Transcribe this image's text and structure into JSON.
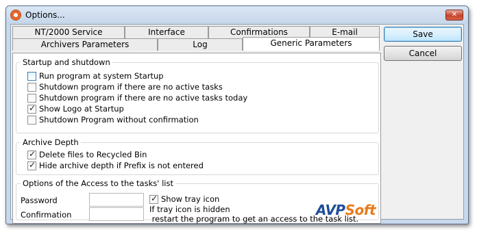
{
  "window": {
    "title": "Options...",
    "close_label": "✕"
  },
  "tabs": {
    "row1": [
      "NT/2000 Service",
      "Interface",
      "Confirmations",
      "E-mail"
    ],
    "row2": [
      "Archivers Parameters",
      "Log",
      "Generic Parameters"
    ],
    "active": "Generic Parameters"
  },
  "startup": {
    "title": "Startup and shutdown",
    "items": [
      {
        "label": "Run program at system Startup",
        "checked": false
      },
      {
        "label": "Shutdown program if there are no active tasks",
        "checked": false
      },
      {
        "label": "Shutdown program if there are no active tasks today",
        "checked": false
      },
      {
        "label": "Show Logo at Startup",
        "checked": true
      },
      {
        "label": "Shutdown Program without confirmation",
        "checked": false
      }
    ]
  },
  "archive": {
    "title": "Archive Depth",
    "items": [
      {
        "label": "Delete files to Recycled Bin",
        "checked": true
      },
      {
        "label": "Hide archive depth if Prefix is not entered",
        "checked": true
      }
    ]
  },
  "access": {
    "title": "Options of the Access to the tasks' list",
    "password_label": "Password",
    "password_value": "",
    "confirmation_label": "Confirmation",
    "confirmation_value": "",
    "tray_label": "Show tray icon",
    "tray_checked": true,
    "hint_line1": "If tray icon is hidden",
    "hint_line2": " restart the program to get an access to the task list."
  },
  "logo": {
    "part1": "AVP",
    "part2": "Soft"
  },
  "buttons": {
    "save": "Save",
    "cancel": "Cancel"
  }
}
